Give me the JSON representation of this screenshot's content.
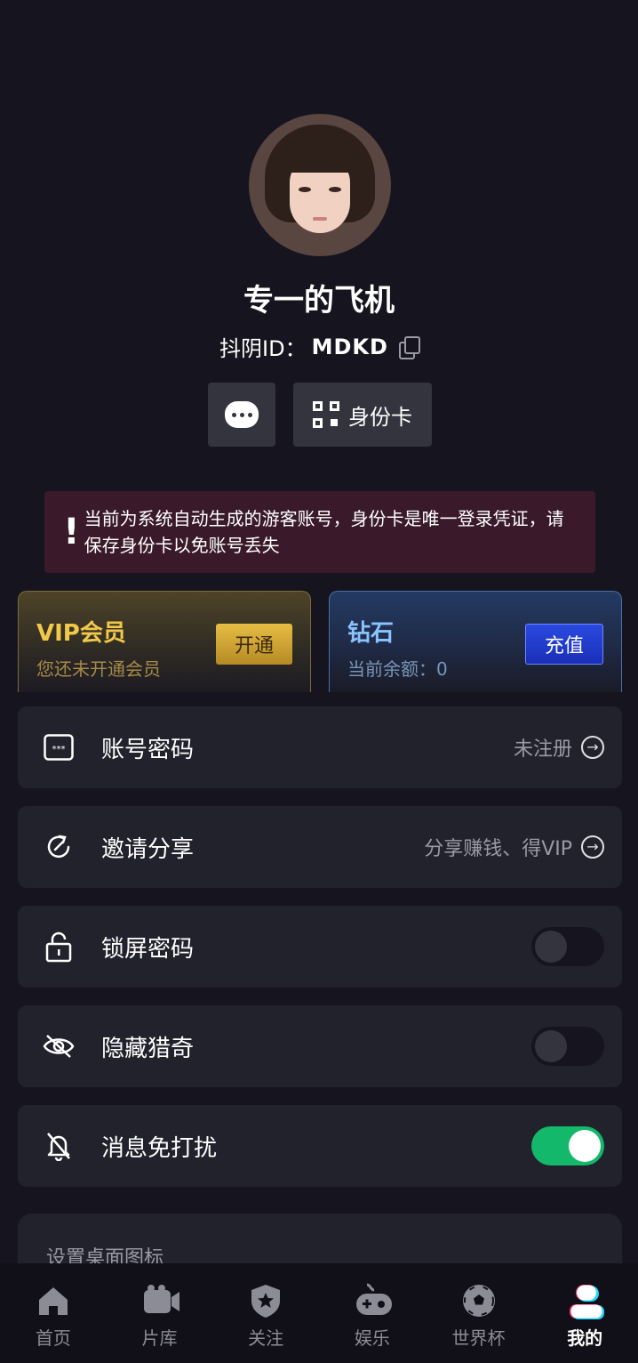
{
  "profile": {
    "nickname": "专一的飞机",
    "id_label": "抖阴ID：",
    "id_value": "MDKD",
    "chat_button": "chat-icon",
    "id_card_label": "身份卡"
  },
  "notice": {
    "icon": "!",
    "text": "当前为系统自动生成的游客账号，身份卡是唯一登录凭证，请保存身份卡以免账号丢失"
  },
  "vip": {
    "title": "VIP会员",
    "subtitle": "您还未开通会员",
    "button": "开通"
  },
  "diamond": {
    "title": "钻石",
    "subtitle": "当前余额：0",
    "button": "充值"
  },
  "menu": [
    {
      "label": "账号密码",
      "right": "未注册",
      "icon": "password-icon"
    },
    {
      "label": "邀请分享",
      "right": "分享赚钱、得VIP",
      "icon": "share-icon"
    },
    {
      "label": "锁屏密码",
      "toggle": false,
      "icon": "lock-icon"
    },
    {
      "label": "隐藏猎奇",
      "toggle": false,
      "icon": "eye-off-icon"
    },
    {
      "label": "消息免打扰",
      "toggle": true,
      "icon": "bell-off-icon"
    }
  ],
  "settings_card": {
    "title": "设置桌面图标"
  },
  "tabbar": [
    {
      "label": "首页",
      "icon": "home-icon"
    },
    {
      "label": "片库",
      "icon": "video-icon"
    },
    {
      "label": "关注",
      "icon": "star-shield-icon"
    },
    {
      "label": "娱乐",
      "icon": "gamepad-icon"
    },
    {
      "label": "世界杯",
      "icon": "soccer-ball-icon"
    },
    {
      "label": "我的",
      "icon": "profile-icon",
      "active": true
    }
  ],
  "colors": {
    "background": "#16151f",
    "card": "#22222c",
    "vip_gold": "#f2c84b",
    "diamond_blue": "#8bc3ff",
    "toggle_on": "#13b86a"
  }
}
